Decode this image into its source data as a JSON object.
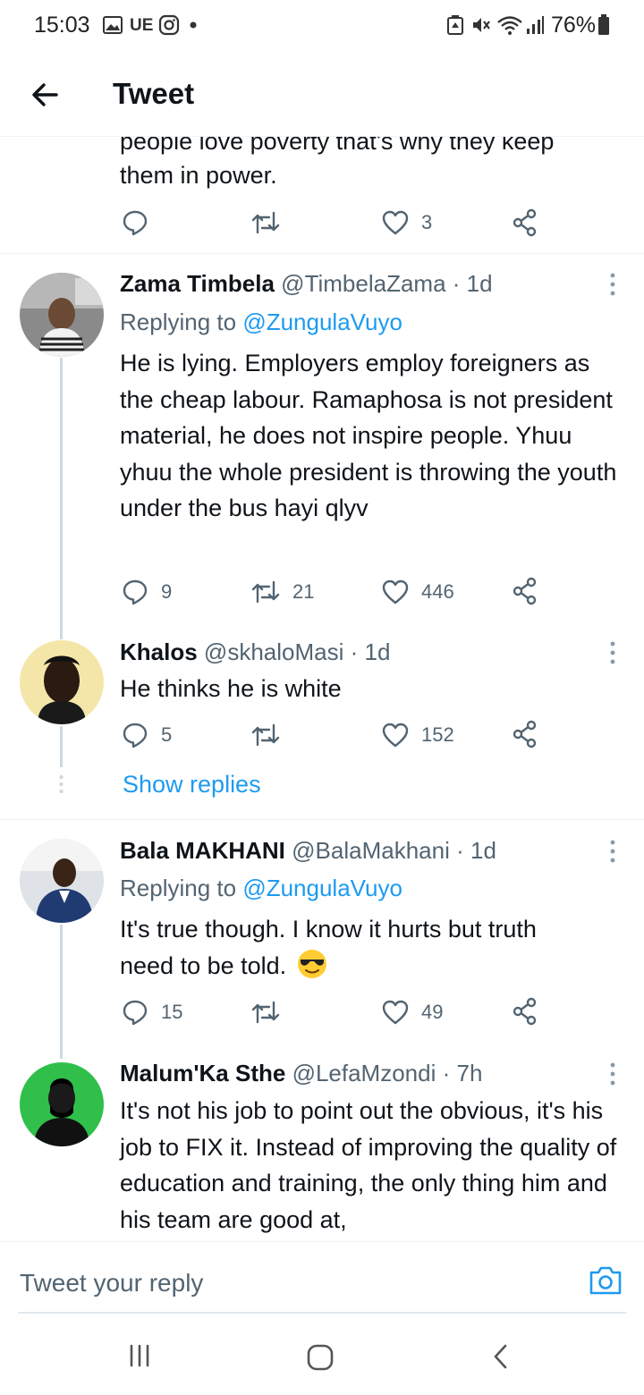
{
  "status_bar": {
    "time": "15:03",
    "carrier_badge": "UE",
    "battery": "76%"
  },
  "header": {
    "title": "Tweet"
  },
  "top_tweet": {
    "text_partial_line": "people love poverty that's why they keep",
    "text_last_line": "them in power.",
    "reply_count": "",
    "retweet_count": "",
    "like_count": "3"
  },
  "replies": [
    {
      "name": "Zama Timbela",
      "handle": "@TimbelaZama",
      "time": "· 1d",
      "replying_prefix": "Replying to",
      "replying_to": "@ZungulaVuyo",
      "text": "He is lying. Employers employ foreigners as the cheap labour. Ramaphosa is not president material, he does not inspire people. Yhuu yhuu the whole president is throwing the youth under the bus hayi qlyv",
      "reply_count": "9",
      "retweet_count": "21",
      "like_count": "446"
    },
    {
      "name": "Khalos",
      "handle": "@skhaloMasi",
      "time": "· 1d",
      "text": "He thinks he is white",
      "reply_count": "5",
      "retweet_count": "",
      "like_count": "152"
    },
    {
      "name": "Bala MAKHANI",
      "handle": "@BalaMakhani",
      "time": "· 1d",
      "replying_prefix": "Replying to",
      "replying_to": "@ZungulaVuyo",
      "text_line1": "It's true though. I know it hurts but truth",
      "text_line2": "need to be told.",
      "emoji": "😎",
      "reply_count": "15",
      "retweet_count": "",
      "like_count": "49"
    },
    {
      "name": "Malum'Ka Sthe",
      "handle": "@LefaMzondi",
      "time": "· 7h",
      "text": "It's not his job to point out the obvious, it's his job to FIX it. Instead of improving the quality of education and training, the only thing him and his team are good at,"
    }
  ],
  "show_replies": "Show replies",
  "reply_bar": {
    "placeholder": "Tweet your reply"
  },
  "icons": {
    "back": "arrow-left-icon",
    "reply": "speech-bubble-icon",
    "retweet": "retweet-icon",
    "like": "heart-icon",
    "share": "share-icon",
    "more": "vertical-dots-icon",
    "camera": "camera-icon"
  },
  "colors": {
    "accent": "#1d9bf0",
    "secondary_text": "#536471",
    "primary_text": "#0f1419",
    "thread_line": "#cfd9de"
  }
}
